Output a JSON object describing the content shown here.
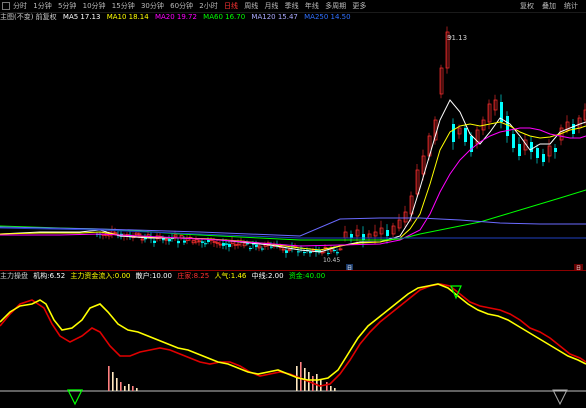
{
  "toolbar": {
    "checkbox_label": "分时",
    "periods": [
      "1分钟",
      "5分钟",
      "10分钟",
      "15分钟",
      "30分钟",
      "60分钟",
      "2小时",
      "日线",
      "周线",
      "月线",
      "季线",
      "年线",
      "多周期",
      "更多"
    ],
    "active_period": "日线",
    "right_buttons": [
      "复权",
      "叠加",
      "统计"
    ]
  },
  "ma_row": {
    "title": "主图(不变) 前复权",
    "ma5": "MA5 17.13",
    "ma10": "MA10 18.14",
    "ma20": "MA20 19.72",
    "ma60": "MA60 16.70",
    "ma120": "MA120 15.47",
    "ma250": "MA250 14.50"
  },
  "annotations": {
    "high_price": "31.13",
    "low_price": "10.45",
    "badge_left": "日",
    "badge_right": "日"
  },
  "indicator_row": {
    "name": "主力操盘",
    "label1": "机构:6.52",
    "label2": "主力资金流入:0.00",
    "label3": "散户:10.00",
    "label4": "庄家:8.25",
    "label5": "人气:1.46",
    "label6": "中线:2.00",
    "label7": "资金:40.00"
  },
  "colors": {
    "up": "#ff3030",
    "down": "#00ffff",
    "ma5": "#ffffff",
    "ma10": "#ffff00",
    "ma20": "#ff00ff",
    "ma60": "#00ff00",
    "ma120": "#3030ff",
    "ma250": "#3070ff",
    "ind_red": "#e00000",
    "ind_yellow": "#ffff00"
  }
}
